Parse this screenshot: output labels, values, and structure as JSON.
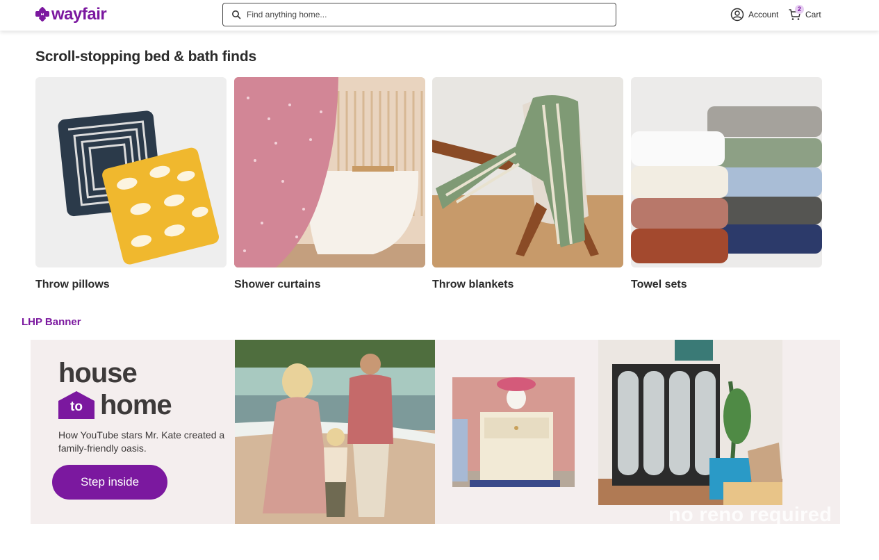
{
  "brand": {
    "logo_text": "wayfair",
    "color": "#7b189f"
  },
  "search": {
    "placeholder": "Find anything home..."
  },
  "header": {
    "account_label": "Account",
    "cart_label": "Cart",
    "cart_count": "2"
  },
  "section": {
    "title": "Scroll-stopping bed & bath finds",
    "cards": [
      {
        "label": "Throw pillows"
      },
      {
        "label": "Shower curtains"
      },
      {
        "label": "Throw blankets"
      },
      {
        "label": "Towel sets"
      }
    ]
  },
  "banner_heading": "LHP Banner",
  "banner": {
    "word_house": "house",
    "word_to": "to",
    "word_home": "home",
    "description": "How YouTube stars Mr. Kate created a family-friendly oasis.",
    "cta_label": "Step inside",
    "watermark": "no reno required"
  }
}
